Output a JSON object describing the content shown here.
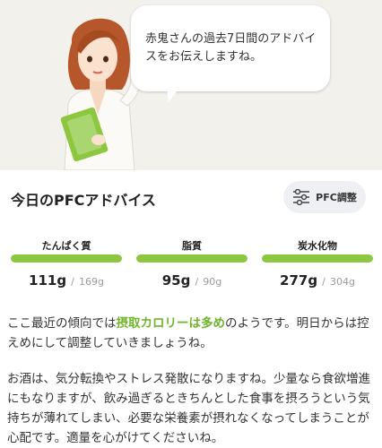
{
  "advisor": {
    "speech": "赤鬼さんの過去7日間のアドバイスをお伝えしますね。"
  },
  "card": {
    "title": "今日のPFCアドバイス",
    "adjust_button_label": "PFC調整",
    "adjust_button_icon": "sliders-icon"
  },
  "macros": [
    {
      "label": "たんぱく質",
      "value": "111g",
      "target": "169g",
      "fill_ratio": 1.0,
      "color": "#8dc63f"
    },
    {
      "label": "脂質",
      "value": "95g",
      "target": "90g",
      "fill_ratio": 1.0,
      "color": "#8dc63f"
    },
    {
      "label": "炭水化物",
      "value": "277g",
      "target": "304g",
      "fill_ratio": 1.0,
      "color": "#8dc63f"
    }
  ],
  "separator": "/",
  "advice": {
    "p1_before": "ここ最近の傾向では",
    "p1_highlight": "摂取カロリーは多め",
    "p1_after": "のようです。明日からは控えめにして調整していきましょうね。",
    "p2": "お酒は、気分転換やストレス発散になりますね。少量なら食欲増進にもなりますが、飲み過ぎるときちんとした食事を摂ろうという気持ちが薄れてしまい、必要な栄養素が摂れなくなってしまうことが心配です。適量を心がけてくださいね。"
  },
  "colors": {
    "accent_green": "#8dc63f",
    "highlight_green": "#6fb52c",
    "hero_background": "#f3f1ec"
  }
}
